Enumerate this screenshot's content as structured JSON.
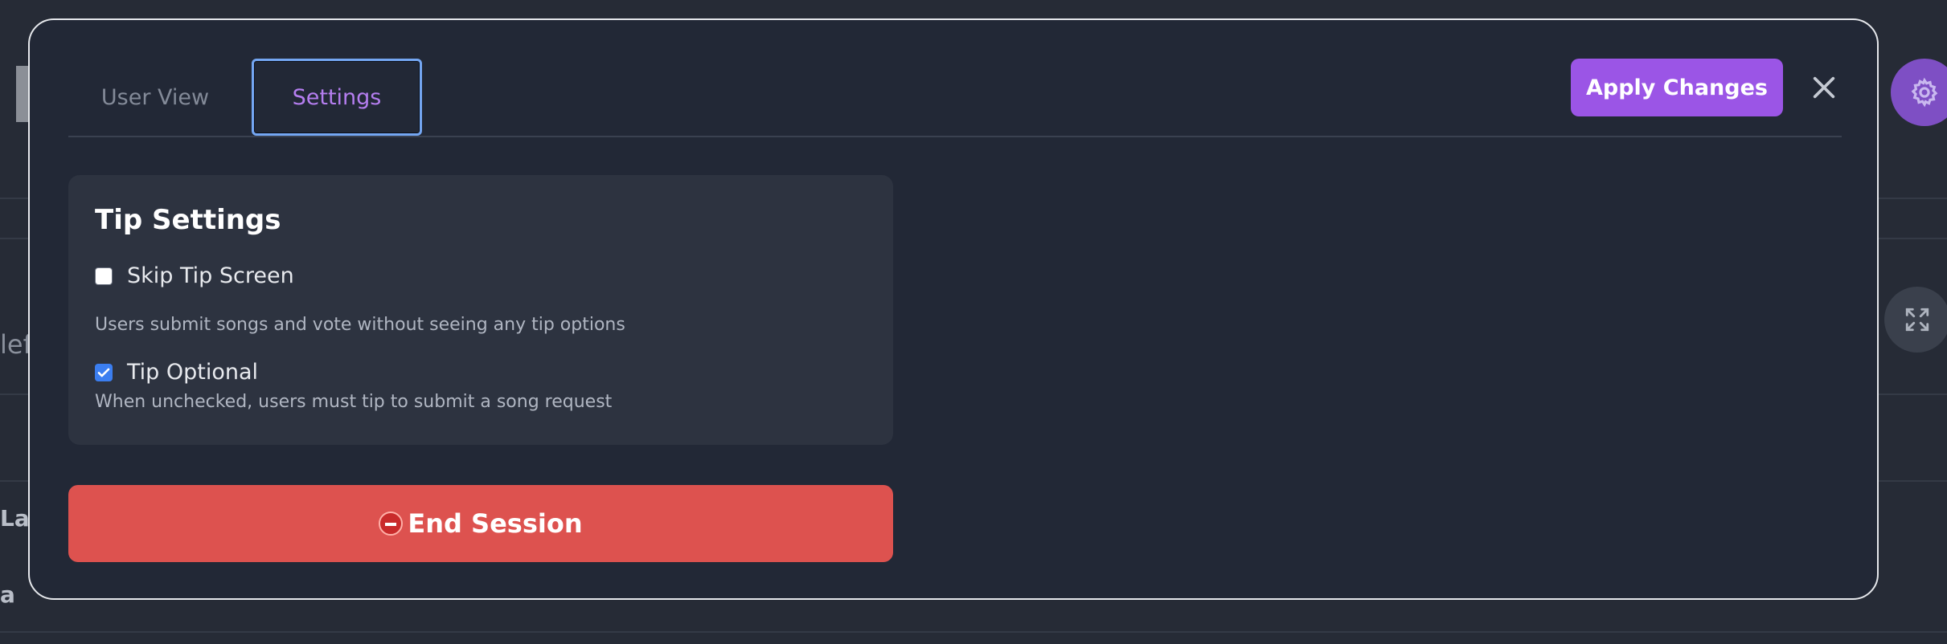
{
  "colors": {
    "accent": "#9b55e6",
    "danger": "#dd524f",
    "tab_active": "#b57ef0",
    "checkbox_checked": "#3b7ef0"
  },
  "background": {
    "fragments": [
      "lef",
      "Las",
      "a"
    ]
  },
  "modal": {
    "tabs": [
      {
        "label": "User View",
        "active": false
      },
      {
        "label": "Settings",
        "active": true
      }
    ],
    "apply_label": "Apply Changes",
    "close_icon": "close-icon",
    "tip_settings": {
      "title": "Tip Settings",
      "skip_tip": {
        "label": "Skip Tip Screen",
        "checked": false
      },
      "skip_help": "Users submit songs and vote without seeing any tip options",
      "tip_optional": {
        "label": "Tip Optional",
        "checked": true
      },
      "tip_help": "When unchecked, users must tip to submit a song request"
    },
    "end_session": {
      "icon": "stop-sign-icon",
      "label": "End Session"
    }
  }
}
